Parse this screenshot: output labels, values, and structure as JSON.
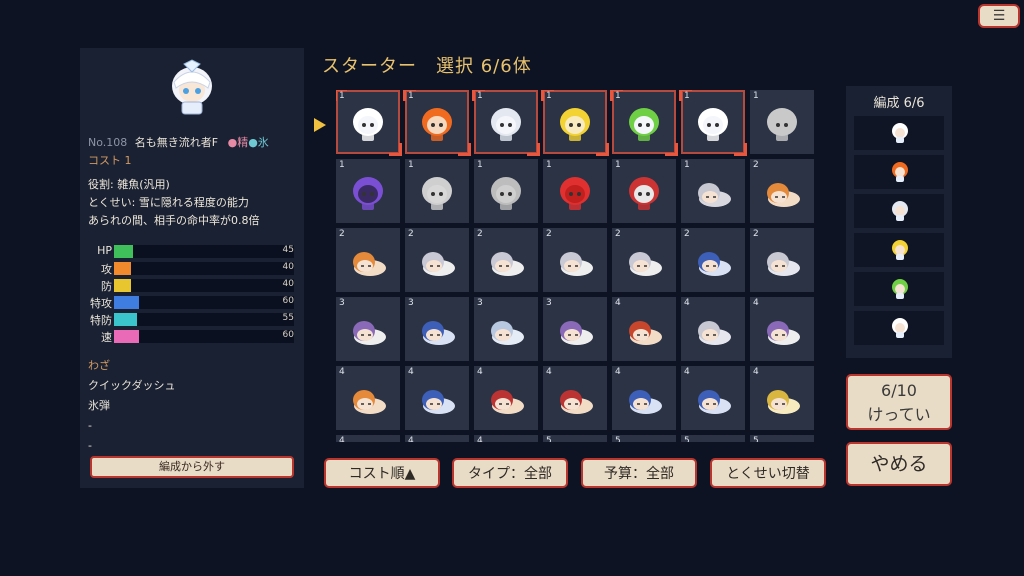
{
  "menu_icon": "hamburger-menu-icon",
  "detail": {
    "no_label": "No.108",
    "name": "名も無き流れ者F",
    "attr_1": "●精",
    "attr_2": "●氷",
    "cost": "コスト 1",
    "role": "役割: 雑魚(汎用)",
    "trait_1": "とくせい: 雪に隠れる程度の能力",
    "trait_2": "あられの間、相手の命中率が0.8倍",
    "stats": [
      {
        "label": "HP",
        "value": "45",
        "color": "#3fc05a",
        "fill": 0.45
      },
      {
        "label": "攻",
        "value": "40",
        "color": "#f08a2c",
        "fill": 0.4
      },
      {
        "label": "防",
        "value": "40",
        "color": "#e8c630",
        "fill": 0.4
      },
      {
        "label": "特攻",
        "value": "60",
        "color": "#3f7ee0",
        "fill": 0.6
      },
      {
        "label": "特防",
        "value": "55",
        "color": "#3bc4cc",
        "fill": 0.55
      },
      {
        "label": "速",
        "value": "60",
        "color": "#ea6ab8",
        "fill": 0.6
      }
    ],
    "moves_header": "わざ",
    "moves": [
      "クイックダッシュ",
      "氷弾",
      "-",
      "-"
    ],
    "remove_button": "編成から外す"
  },
  "title": "スターター　選択 6/6体",
  "grid": [
    {
      "n": "1",
      "sel": true,
      "icon": "white-haired-ice-fairy-sprite",
      "color": "#f4f6fb",
      "hair": "#ffffff"
    },
    {
      "n": "1",
      "sel": true,
      "icon": "orange-haired-fairy-sprite",
      "color": "#f7d9bf",
      "hair": "#f06a20"
    },
    {
      "n": "1",
      "sel": true,
      "icon": "silver-haired-girl-sprite",
      "color": "#f4f6fb",
      "hair": "#e4e8f0"
    },
    {
      "n": "1",
      "sel": true,
      "icon": "blonde-fairy-sprite",
      "color": "#f8ebc0",
      "hair": "#f3d233"
    },
    {
      "n": "1",
      "sel": true,
      "icon": "green-haired-fairy-sprite",
      "color": "#f4f6fb",
      "hair": "#6fcf45"
    },
    {
      "n": "1",
      "sel": true,
      "icon": "white-haired-fairy-sprite",
      "color": "#f4f6fb",
      "hair": "#ffffff"
    },
    {
      "n": "1",
      "sel": false,
      "icon": "white-ghost-sprite",
      "color": "#c9c9c9",
      "hair": "#c9c9c9"
    },
    {
      "n": "1",
      "sel": false,
      "icon": "purple-wisp-sprite",
      "color": "#3a2a64",
      "hair": "#7b4fd3"
    },
    {
      "n": "1",
      "sel": false,
      "icon": "kedama-fluffball-sprite",
      "color": "#d8d8d8",
      "hair": "#cfcfcf"
    },
    {
      "n": "1",
      "sel": false,
      "icon": "grey-cat-sprite",
      "color": "#cfcfcf",
      "hair": "#bdbdbd"
    },
    {
      "n": "1",
      "sel": false,
      "icon": "red-blob-sprite",
      "color": "#c21f1f",
      "hair": "#e03030"
    },
    {
      "n": "1",
      "sel": false,
      "icon": "yin-yang-orb-sprite",
      "color": "#e8e8e8",
      "hair": "#c33"
    },
    {
      "n": "1",
      "sel": false,
      "icon": "lying-maid-fairy-sprite",
      "color": "#d8d8de",
      "hair": "#c8c8d2"
    },
    {
      "n": "2",
      "sel": false,
      "icon": "lying-rabbit-girl-sprite",
      "color": "#f3dcc6",
      "hair": "#e48a3a"
    },
    {
      "n": "2",
      "sel": false,
      "icon": "lying-orange-fairy-sprite",
      "color": "#f3dcc6",
      "hair": "#e48a3a"
    },
    {
      "n": "2",
      "sel": false,
      "icon": "lying-ribbon-girl-sprite",
      "color": "#eee",
      "hair": "#c9c9d6"
    },
    {
      "n": "2",
      "sel": false,
      "icon": "lying-ribbon-girl-sprite",
      "color": "#eee",
      "hair": "#c9c9d6"
    },
    {
      "n": "2",
      "sel": false,
      "icon": "lying-ribbon-girl-sprite",
      "color": "#eee",
      "hair": "#c9c9d6"
    },
    {
      "n": "2",
      "sel": false,
      "icon": "lying-ribbon-girl-sprite",
      "color": "#eee",
      "hair": "#c9c9d6"
    },
    {
      "n": "2",
      "sel": false,
      "icon": "lying-blue-haired-girl-sprite",
      "color": "#d9e2f5",
      "hair": "#3d5fb8"
    },
    {
      "n": "2",
      "sel": false,
      "icon": "lying-white-maid-sprite",
      "color": "#e6e6ee",
      "hair": "#c8c8d2"
    },
    {
      "n": "3",
      "sel": false,
      "icon": "lying-purple-girl-sprite",
      "color": "#eee",
      "hair": "#8a6ab8"
    },
    {
      "n": "3",
      "sel": false,
      "icon": "lying-blue-haired-girl-sprite",
      "color": "#d9e2f5",
      "hair": "#3d5fb8"
    },
    {
      "n": "3",
      "sel": false,
      "icon": "lying-silver-girl-sprite",
      "color": "#e6ecf5",
      "hair": "#b8c8e0"
    },
    {
      "n": "3",
      "sel": false,
      "icon": "lying-purple-girl-sprite",
      "color": "#eee",
      "hair": "#8a6ab8"
    },
    {
      "n": "4",
      "sel": false,
      "icon": "lying-red-haired-girl-sprite",
      "color": "#f3dcc6",
      "hair": "#c8462c"
    },
    {
      "n": "4",
      "sel": false,
      "icon": "lying-white-maid-sprite",
      "color": "#e6e6ee",
      "hair": "#c8c8d2"
    },
    {
      "n": "4",
      "sel": false,
      "icon": "lying-purple-girl-sprite",
      "color": "#eee",
      "hair": "#8a6ab8"
    },
    {
      "n": "4",
      "sel": false,
      "icon": "lying-orange-girl-sprite",
      "color": "#f3dcc6",
      "hair": "#e48a3a"
    },
    {
      "n": "4",
      "sel": false,
      "icon": "lying-blue-haired-girl-sprite",
      "color": "#d9e2f5",
      "hair": "#3d5fb8"
    },
    {
      "n": "4",
      "sel": false,
      "icon": "lying-shrine-maiden-sprite",
      "color": "#f3dcc6",
      "hair": "#b33"
    },
    {
      "n": "4",
      "sel": false,
      "icon": "lying-shrine-maiden-sprite",
      "color": "#f3dcc6",
      "hair": "#b33"
    },
    {
      "n": "4",
      "sel": false,
      "icon": "lying-blue-haired-girl-sprite",
      "color": "#d9e2f5",
      "hair": "#3d5fb8"
    },
    {
      "n": "4",
      "sel": false,
      "icon": "lying-blue-haired-girl-sprite",
      "color": "#d9e2f5",
      "hair": "#3d5fb8"
    },
    {
      "n": "4",
      "sel": false,
      "icon": "lying-blonde-girl-sprite",
      "color": "#f8ebc0",
      "hair": "#d8b640"
    },
    {
      "n": "4",
      "sel": false,
      "icon": "partial-row-sprite",
      "color": "#2b3345",
      "hair": "#2b3345"
    },
    {
      "n": "4",
      "sel": false,
      "icon": "partial-row-sprite",
      "color": "#2b3345",
      "hair": "#2b3345"
    },
    {
      "n": "4",
      "sel": false,
      "icon": "partial-row-sprite",
      "color": "#2b3345",
      "hair": "#2b3345"
    },
    {
      "n": "5",
      "sel": false,
      "icon": "partial-row-sprite",
      "color": "#2b3345",
      "hair": "#2b3345"
    },
    {
      "n": "5",
      "sel": false,
      "icon": "partial-row-sprite",
      "color": "#2b3345",
      "hair": "#2b3345"
    },
    {
      "n": "5",
      "sel": false,
      "icon": "partial-row-sprite",
      "color": "#2b3345",
      "hair": "#2b3345"
    },
    {
      "n": "5",
      "sel": false,
      "icon": "partial-row-sprite",
      "color": "#2b3345",
      "hair": "#2b3345"
    }
  ],
  "sort_buttons": {
    "cost": "コスト順▲",
    "type": "タイプ：全部",
    "budget": "予算：全部",
    "trait": "とくせい切替"
  },
  "party": {
    "header": "編成 6/6",
    "members": [
      {
        "icon": "white-haired-ice-fairy-icon",
        "hair": "#ffffff"
      },
      {
        "icon": "orange-haired-fairy-icon",
        "hair": "#f06a20"
      },
      {
        "icon": "silver-haired-girl-icon",
        "hair": "#e4e8f0"
      },
      {
        "icon": "blonde-fairy-icon",
        "hair": "#f3d233"
      },
      {
        "icon": "green-haired-fairy-icon",
        "hair": "#6fcf45"
      },
      {
        "icon": "white-haired-fairy-icon",
        "hair": "#ffffff"
      }
    ]
  },
  "count_button": {
    "line1": "6/10",
    "line2": "けってい"
  },
  "quit_button": "やめる"
}
